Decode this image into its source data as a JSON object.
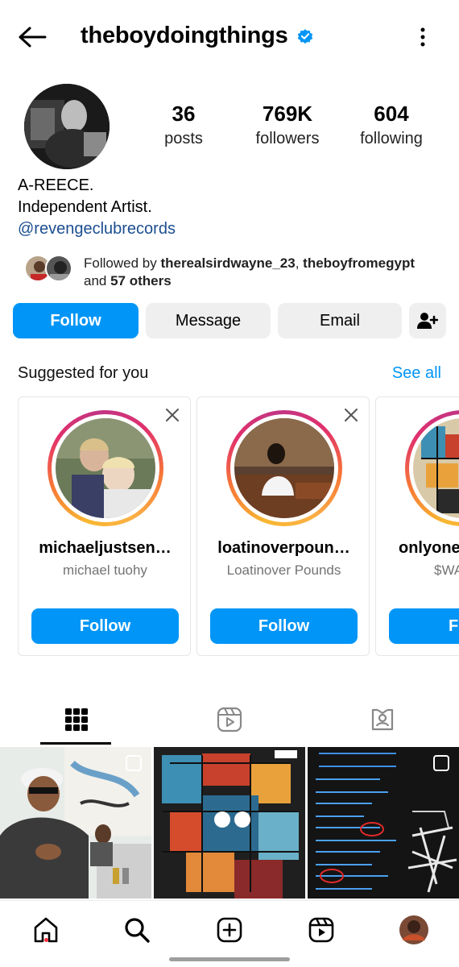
{
  "header": {
    "username": "theboydoingthings",
    "verified": true,
    "accent": "#0095f6"
  },
  "profile": {
    "stats": [
      {
        "value": "36",
        "label": "posts"
      },
      {
        "value": "769K",
        "label": "followers"
      },
      {
        "value": "604",
        "label": "following"
      }
    ],
    "name": "A-REECE.",
    "bio_line": "Independent Artist.",
    "link": "@revengeclubrecords",
    "followed_by_prefix": "Followed by ",
    "followed_by_user1": "therealsirdwayne_23",
    "followed_by_sep": ", ",
    "followed_by_user2": "theboyfromegypt",
    "followed_by_and": "and ",
    "followed_by_others": "57 others"
  },
  "actions": {
    "follow": "Follow",
    "message": "Message",
    "email": "Email",
    "add_user_icon": "add-person-icon"
  },
  "suggested": {
    "title": "Suggested for you",
    "see_all": "See all",
    "cards": [
      {
        "username": "michaeljustsen…",
        "name": "michael tuohy",
        "button": "Follow"
      },
      {
        "username": "loatinoverpoun…",
        "name": "Loatinover Pounds",
        "button": "Follow"
      },
      {
        "username": "onlyone",
        "name": "$WA",
        "button": "Fol"
      }
    ]
  },
  "tabs": [
    {
      "icon": "grid-icon",
      "active": true
    },
    {
      "icon": "reels-icon",
      "active": false
    },
    {
      "icon": "tagged-icon",
      "active": false
    }
  ],
  "bottom_nav": [
    {
      "icon": "home-icon",
      "active": true
    },
    {
      "icon": "search-icon",
      "active": false
    },
    {
      "icon": "create-icon",
      "active": false
    },
    {
      "icon": "reels-icon",
      "active": false
    },
    {
      "icon": "profile-avatar",
      "active": false
    }
  ]
}
